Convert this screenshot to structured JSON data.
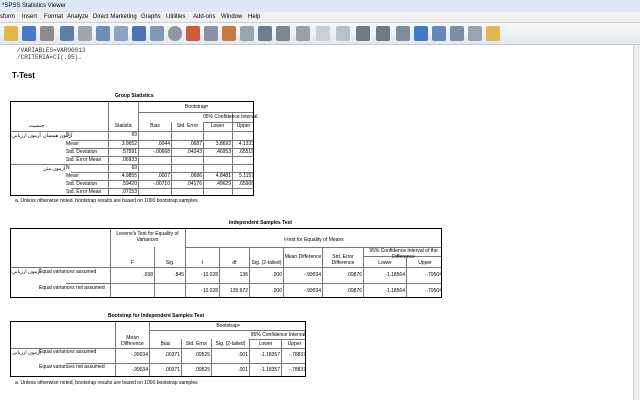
{
  "window": {
    "title": "*SPSS Statistics Viewer"
  },
  "menu": [
    "sform",
    "Insert",
    "Format",
    "Analyze",
    "Direct Marketing",
    "Graphs",
    "Utilities",
    "Add-ons",
    "Window",
    "Help"
  ],
  "syntax": [
    "/VARIABLES=VAR00013",
    "/CRITERIA=CI(.95)."
  ],
  "heading": "T-Test",
  "group_stats": {
    "title": "Group Statistics",
    "bootstrap_header": "Bootstrapᵃ",
    "ci_header": "95% Confidence Interval",
    "col_headers": {
      "statistic": "Statistic",
      "bias": "Bias",
      "std_error": "Std. Error",
      "lower": "Lower",
      "upper": "Upper"
    },
    "var_label": "جنسیت",
    "row_var": "آزمون ارزیابی",
    "group1": "آزمون همسان",
    "group2": "آزمون متن",
    "rows": [
      {
        "label": "N",
        "statistic": "69",
        "bias": "",
        "std_error": "",
        "lower": "",
        "upper": ""
      },
      {
        "label": "Mean",
        "statistic": "3.9652",
        "bias": ".0044",
        "std_error": ".0687",
        "lower": "3.8693",
        "upper": "4.1333"
      },
      {
        "label": "Std. Deviation",
        "statistic": ".57591",
        "bias": "-.00668",
        "std_error": ".04243",
        "lower": ".46953",
        "upper": ".65519"
      },
      {
        "label": "Std. Error Mean",
        "statistic": ".06933",
        "bias": "",
        "std_error": "",
        "lower": "",
        "upper": ""
      },
      {
        "label": "N",
        "statistic": "69",
        "bias": "",
        "std_error": "",
        "lower": "",
        "upper": ""
      },
      {
        "label": "Mean",
        "statistic": "4.9855",
        "bias": ".0007",
        "std_error": ".0686",
        "lower": "4.8481",
        "upper": "5.1157"
      },
      {
        "label": "Std. Deviation",
        "statistic": ".59420",
        "bias": "-.00710",
        "std_error": ".04176",
        "lower": ".49629",
        "upper": ".65906"
      },
      {
        "label": "Std. Error Mean",
        "statistic": ".07153",
        "bias": "",
        "std_error": "",
        "lower": "",
        "upper": ""
      }
    ],
    "footnote": "a. Unless otherwise noted, bootstrap results are based on 1000 bootstrap samples"
  },
  "ind_test": {
    "title": "Independent Samples Test",
    "levene_header": "Levene's Test for Equality of Variances",
    "ttest_header": "t-test for Equality of Means",
    "ci_header": "95% Confidence Interval of the Difference",
    "col_headers": {
      "f": "F",
      "sig": "Sig.",
      "t": "t",
      "df": "df",
      "sig2": "Sig. (2-tailed)",
      "mean_diff": "Mean Difference",
      "se_diff": "Std. Error Difference",
      "lower": "Lower",
      "upper": "Upper"
    },
    "row_var": "آزمون ارزیابی",
    "rows": [
      {
        "label": "Equal variances assumed",
        "f": ".038",
        "sig": ".845",
        "t": "-10.028",
        "df": "136",
        "sig2": ".000",
        "mean_diff": "-.99034",
        "se_diff": ".09876",
        "lower": "-1.18564",
        "upper": "-.79504"
      },
      {
        "label": "Equal variances not assumed",
        "f": "",
        "sig": "",
        "t": "-10.028",
        "df": "135.972",
        "sig2": ".000",
        "mean_diff": "-.99034",
        "se_diff": ".09876",
        "lower": "-1.18564",
        "upper": "-.79504"
      }
    ]
  },
  "boot_test": {
    "title": "Bootstrap for Independent Samples Test",
    "bootstrap_header": "Bootstrapᵃ",
    "ci_header": "95% Confidence Interval",
    "col_headers": {
      "mean_diff": "Mean Difference",
      "bias": "Bias",
      "std_error": "Std. Error",
      "sig2": "Sig. (2-tailed)",
      "lower": "Lower",
      "upper": "Upper"
    },
    "row_var": "آزمون ارزیابی",
    "rows": [
      {
        "label": "Equal variances assumed",
        "mean_diff": "-.99034",
        "bias": ".00371",
        "std_error": ".09525",
        "sig2": ".001",
        "lower": "-1.18357",
        "upper": "-.78837"
      },
      {
        "label": "Equal variances not assumed",
        "mean_diff": "-.99034",
        "bias": ".00371",
        "std_error": ".09525",
        "sig2": ".001",
        "lower": "-1.18357",
        "upper": "-.78837"
      }
    ],
    "footnote": "a. Unless otherwise noted, bootstrap results are based on 1000 bootstrap samples"
  },
  "toolbar_icons": [
    "open-icon",
    "save-icon",
    "print-icon",
    "dialog-recall-icon",
    "undo-icon",
    "redo-icon",
    "goto-data-icon",
    "goto-case-icon",
    "variables-icon",
    "run-descriptives-icon",
    "chart-icon",
    "split-file-icon",
    "weight-icon",
    "select-cases-icon",
    "value-labels-icon",
    "designate-window-icon",
    "stop-icon",
    "back-arrow-icon",
    "forward-arrow-icon",
    "add-icon",
    "remove-icon",
    "promote-icon",
    "demote-icon",
    "collapse-icon",
    "show-all-icon",
    "hide-icon",
    "insert-output-icon"
  ]
}
